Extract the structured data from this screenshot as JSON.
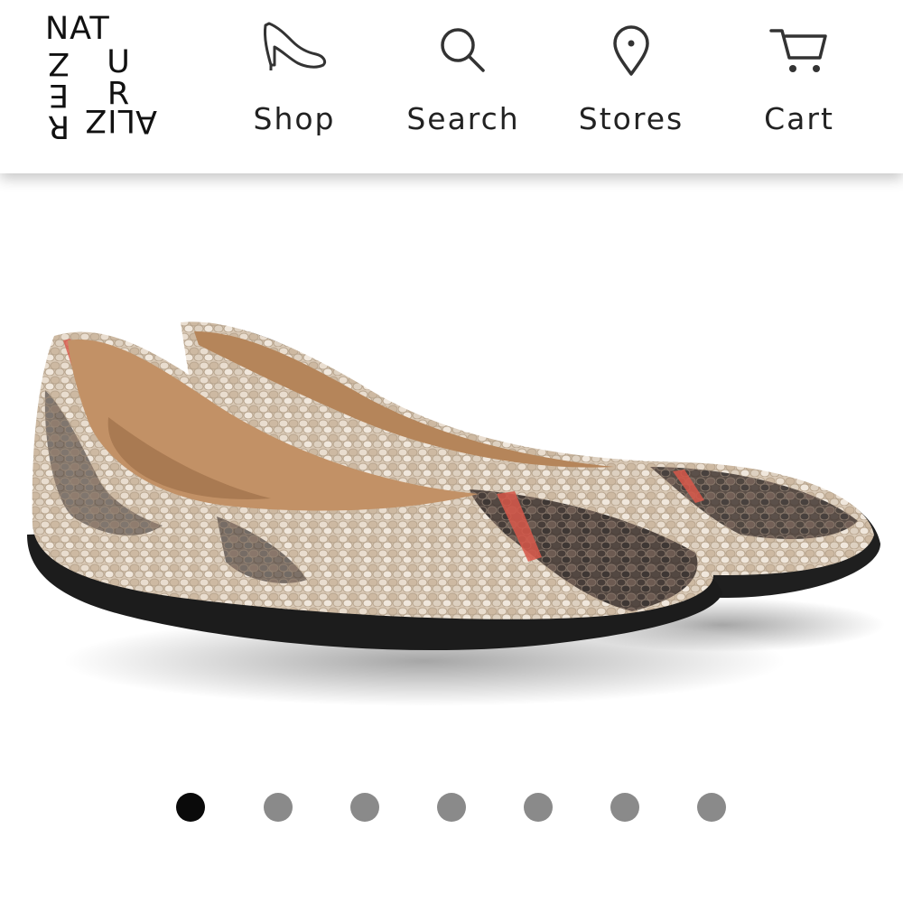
{
  "brand": {
    "logo_text": "NATURALIZER",
    "logo_top": "NAT",
    "logo_left": [
      "Z",
      "E",
      "R"
    ],
    "logo_right": [
      "U",
      "R"
    ],
    "logo_bottom": "LIZ",
    "logo_a": "A"
  },
  "nav": {
    "shop": {
      "label": "Shop",
      "icon": "high-heel-icon"
    },
    "search": {
      "label": "Search",
      "icon": "search-icon"
    },
    "stores": {
      "label": "Stores",
      "icon": "location-pin-icon"
    },
    "cart": {
      "label": "Cart",
      "icon": "cart-icon"
    }
  },
  "product": {
    "image": "snakeskin-print-ballet-flats-image"
  },
  "carousel": {
    "total": 7,
    "active_index": 0
  },
  "colors": {
    "active_dot": "#0a0a0a",
    "inactive_dot": "#8a8a8a"
  }
}
